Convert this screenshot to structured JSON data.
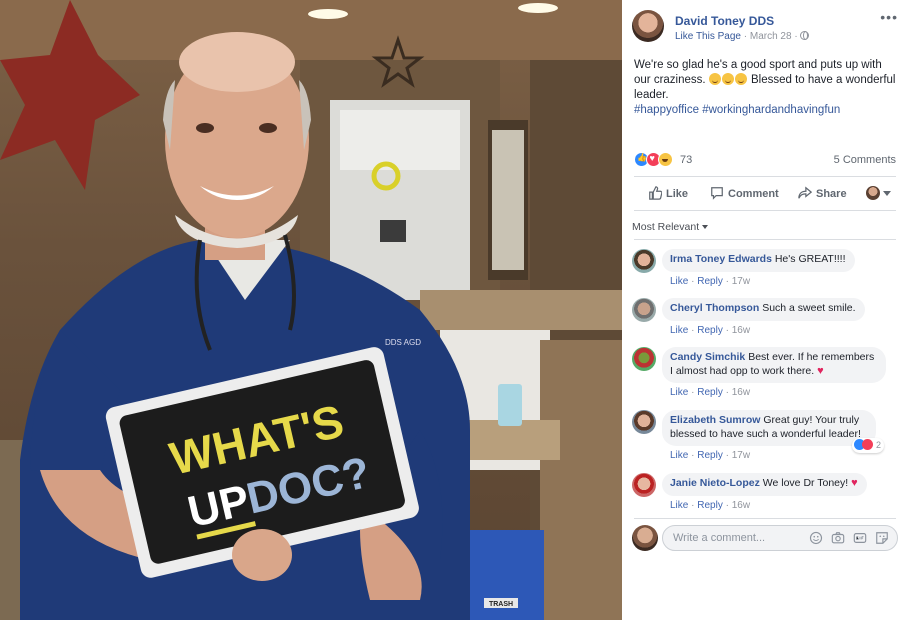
{
  "post": {
    "author": "David Toney DDS",
    "like_page": "Like This Page",
    "date": "March 28",
    "separator": "·",
    "more": "•••",
    "text_line": "We're so glad he's a good sport and puts up with our craziness.",
    "text_tail": "Blessed to have a wonderful leader.",
    "hashtags": "#happyoffice #workinghardandhavingfun",
    "reaction_count": "73",
    "comment_count": "5 Comments"
  },
  "actions": {
    "like": "Like",
    "comment": "Comment",
    "share": "Share"
  },
  "sort": {
    "label": "Most Relevant"
  },
  "comments": [
    {
      "name": "Irma Toney Edwards",
      "text": "He's GREAT!!!!",
      "like": "Like",
      "reply": "Reply",
      "time": "17w"
    },
    {
      "name": "Cheryl Thompson",
      "text": "Such a sweet smile.",
      "like": "Like",
      "reply": "Reply",
      "time": "16w"
    },
    {
      "name": "Candy Simchik",
      "text": "Best ever. If he remembers I almost had opp to work there.",
      "like": "Like",
      "reply": "Reply",
      "time": "16w"
    },
    {
      "name": "Elizabeth Sumrow",
      "text": "Great guy! Your truly blessed to have such a wonderful leader!",
      "like": "Like",
      "reply": "Reply",
      "time": "17w",
      "reactions": "2"
    },
    {
      "name": "Janie Nieto-Lopez",
      "text": "We love Dr Toney!",
      "like": "Like",
      "reply": "Reply",
      "time": "16w"
    }
  ],
  "composer": {
    "placeholder": "Write a comment..."
  },
  "photo": {
    "sign_line1": "WHAT'S",
    "sign_line2a": "UP",
    "sign_line2b": "DOC?",
    "scrub_label": "DDS AGD",
    "trash_label": "TRASH"
  },
  "colors": {
    "link": "#365899",
    "muted": "#90949c",
    "bubble": "#f2f3f5",
    "sign_yellow": "#e6d94a"
  }
}
